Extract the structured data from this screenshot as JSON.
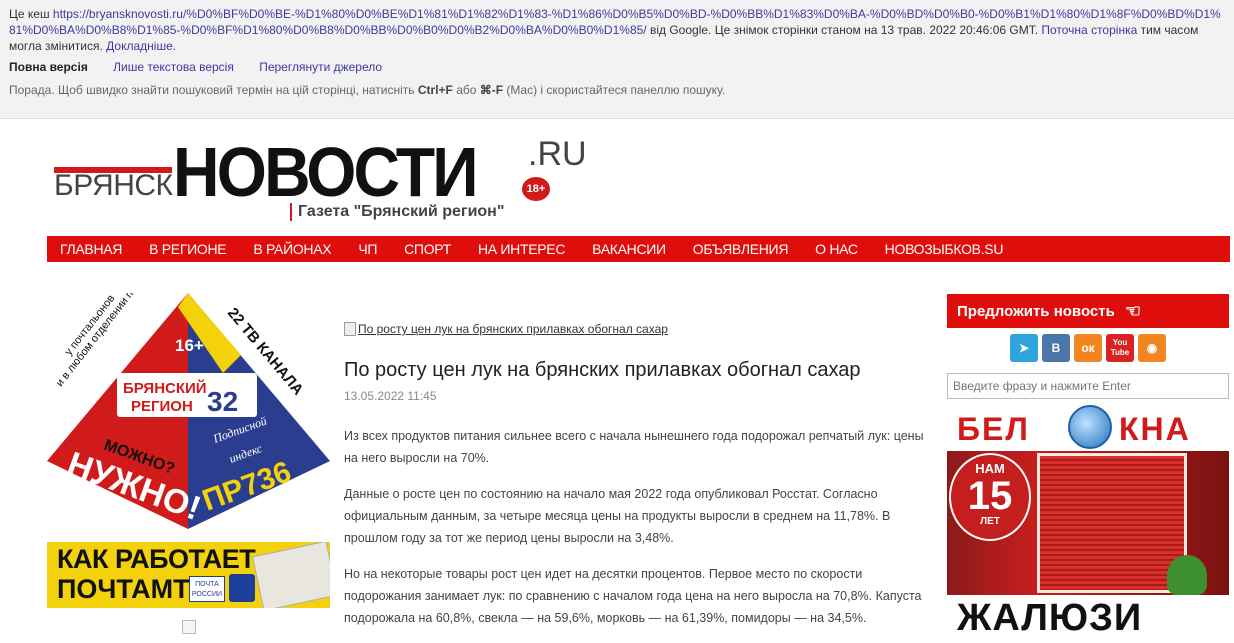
{
  "cache_bar": {
    "prefix": "Це кеш ",
    "url": "https://bryansknovosti.ru/%D0%BF%D0%BE-%D1%80%D0%BE%D1%81%D1%82%D1%83-%D1%86%D0%B5%D0%BD-%D0%BB%D1%83%D0%BA-%D0%BD%D0%B0-%D0%B1%D1%80%D1%8F%D0%BD%D1%81%D0%BA%D0%B8%D1%85-%D0%BF%D1%80%D0%B8%D0%BB%D0%B0%D0%B2%D0%BA%D0%B0%D1%85/",
    "suffix": " від Google. Це знімок сторінки станом на 13 трав. 2022 20:46:06 GMT. ",
    "current_page_link": "Поточна сторінка",
    "middle_text": " тим часом могла змінитися. ",
    "learn_more": "Докладніше.",
    "links": {
      "full": "Повна версія",
      "text_only": "Лише текстова версія",
      "view_source": "Переглянути джерело"
    },
    "tip_prefix": "Порада. Щоб швидко знайти пошуковий термін на цій сторінці, натисніть ",
    "tip_keys": "Ctrl+F",
    "tip_middle": " або ",
    "tip_mac_keys": "⌘-F",
    "tip_suffix": " (Mac) і скористайтеся панеллю пошуку."
  },
  "logo": {
    "bryansk": "БРЯНСК",
    "novosti": "НОВОСТИ",
    "ru": ".RU",
    "age": "18+",
    "subtitle": "Газета \"Брянский регион\""
  },
  "nav": {
    "items": [
      "ГЛАВНАЯ",
      "В РЕГИОНЕ",
      "В РАЙОНАХ",
      "ЧП",
      "СПОРТ",
      "НА ИНТЕРЕС",
      "ВАКАНСИИ",
      "ОБЪЯВЛЕНИЯ",
      "О НАС",
      "НОВОЗЫБКОВ.SU"
    ]
  },
  "ad_pyramid": {
    "left_text1": "у почтальонов",
    "left_text2": "и в любом отделении почтамта",
    "age": "16+",
    "channels": "22 ТВ КАНАЛА",
    "brand1": "БРЯНСКИЙ",
    "brand2": "РЕГИОН",
    "brand_num": "32",
    "question": "МОЖНО?",
    "answer": "НУЖНО!",
    "subscribe1": "Подписной",
    "subscribe2": "индекс",
    "index": "ПР736",
    "colors": {
      "red": "#d11a1a",
      "blue": "#2a3d8f",
      "yellow": "#f3d20c"
    }
  },
  "ad_pochtamt": {
    "line1": "КАК РАБОТАЕТ",
    "line2": "ПОЧТАМТ",
    "post_logo": "ПОЧТА РОССИИ"
  },
  "article": {
    "hero_alt": "По росту цен лук на брянских прилавках обогнал сахар",
    "title": "По росту цен лук на брянских прилавках обогнал сахар",
    "date": "13.05.2022 11:45",
    "paragraphs": [
      "Из всех продуктов питания сильнее всего с начала нынешнего года подорожал репчатый лук: цены на него выросли на 70%.",
      "Данные о росте цен по состоянию на начало мая 2022 года опубликовал Росстат. Согласно официальным данным, за четыре месяца цены на продукты выросли в среднем на 11,78%. В прошлом году за тот же период цены выросли на 3,48%.",
      "Но на некоторые товары рост цен идет на десятки процентов. Первое место по скорости подорожания занимает лук: по сравнению с началом года цена на него выросла на 70,8%. Капуста подорожала на 60,8%, свекла — на 59,6%, морковь — на 61,39%, помидоры — на 34,5%."
    ]
  },
  "sidebar": {
    "suggest": "Предложить новость",
    "social": [
      {
        "name": "telegram-icon",
        "glyph": "➤",
        "color": "#2fa3dc"
      },
      {
        "name": "vk-icon",
        "glyph": "В",
        "color": "#4a76a8"
      },
      {
        "name": "odnoklassniki-icon",
        "glyph": "ок",
        "color": "#f2851f"
      },
      {
        "name": "youtube-icon",
        "glyph": "You Tube",
        "color": "#d92323"
      },
      {
        "name": "rss-icon",
        "glyph": "◉",
        "color": "#f2851f"
      }
    ],
    "search_placeholder": "Введите фразу и нажмите Enter",
    "ad_okna": {
      "left": "БЕЛ",
      "right": "КНА",
      "badge_top": "НАМ",
      "badge_num": "15",
      "badge_bottom": "ЛЕТ",
      "bottom": "ЖАЛЮЗИ"
    }
  }
}
